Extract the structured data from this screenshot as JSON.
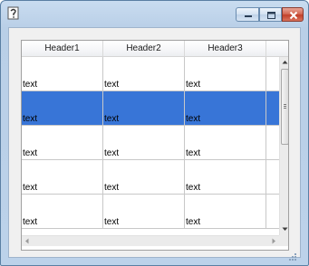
{
  "window": {
    "icons": {
      "app": "application-icon",
      "minimize": "minimize-icon",
      "maximize": "maximize-icon",
      "close": "close-icon"
    },
    "colors": {
      "selection": "#3875d7",
      "close_button": "#c2402a",
      "frame": "#b9cfe7"
    }
  },
  "table": {
    "headers": [
      "Header1",
      "Header2",
      "Header3"
    ],
    "rows": [
      {
        "cells": [
          "text",
          "text",
          "text"
        ],
        "selected": false
      },
      {
        "cells": [
          "text",
          "text",
          "text"
        ],
        "selected": true
      },
      {
        "cells": [
          "text",
          "text",
          "text"
        ],
        "selected": false
      },
      {
        "cells": [
          "text",
          "text",
          "text"
        ],
        "selected": false
      },
      {
        "cells": [
          "text",
          "text",
          "text"
        ],
        "selected": false
      }
    ]
  }
}
